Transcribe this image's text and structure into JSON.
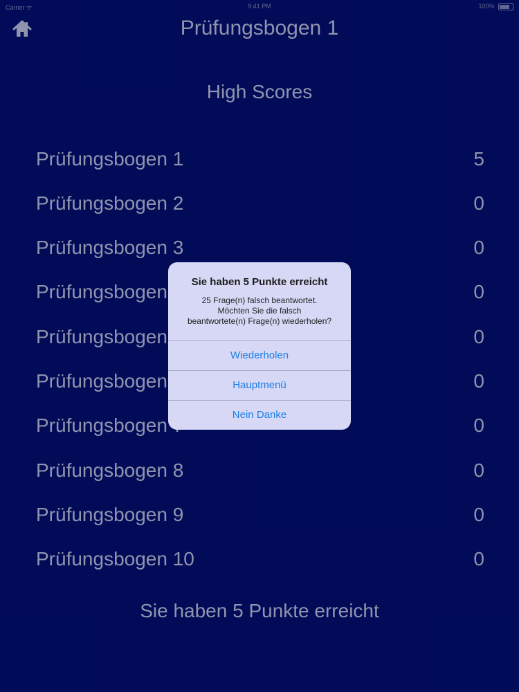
{
  "status_bar": {
    "left": "Carrier ᯤ",
    "center": "9:41 PM",
    "right": "100%"
  },
  "nav": {
    "home_icon": "home-icon",
    "title": "Prüfungsbogen 1"
  },
  "high_scores": {
    "heading": "High Scores",
    "rows": [
      {
        "name": "Prüfungsbogen 1",
        "score": "5"
      },
      {
        "name": "Prüfungsbogen 2",
        "score": "0"
      },
      {
        "name": "Prüfungsbogen 3",
        "score": "0"
      },
      {
        "name": "Prüfungsbogen 4",
        "score": "0"
      },
      {
        "name": "Prüfungsbogen 5",
        "score": "0"
      },
      {
        "name": "Prüfungsbogen 6",
        "score": "0"
      },
      {
        "name": "Prüfungsbogen 7",
        "score": "0"
      },
      {
        "name": "Prüfungsbogen 8",
        "score": "0"
      },
      {
        "name": "Prüfungsbogen 9",
        "score": "0"
      },
      {
        "name": "Prüfungsbogen 10",
        "score": "0"
      }
    ]
  },
  "footer": {
    "text": "Sie haben 5 Punkte erreicht"
  },
  "alert": {
    "title": "Sie haben 5 Punkte erreicht",
    "message_line1": "25 Frage(n) falsch beantwortet.",
    "message_line2": "Möchten Sie die falsch",
    "message_line3": "beantwortete(n) Frage(n) wiederholen?",
    "buttons": [
      {
        "label": "Wiederholen"
      },
      {
        "label": "Hauptmenü"
      },
      {
        "label": "Nein Danke"
      }
    ]
  },
  "colors": {
    "background": "#021070",
    "text": "#c9cde6",
    "alert_background": "#d6d8f6",
    "alert_button": "#1a7ee6"
  }
}
